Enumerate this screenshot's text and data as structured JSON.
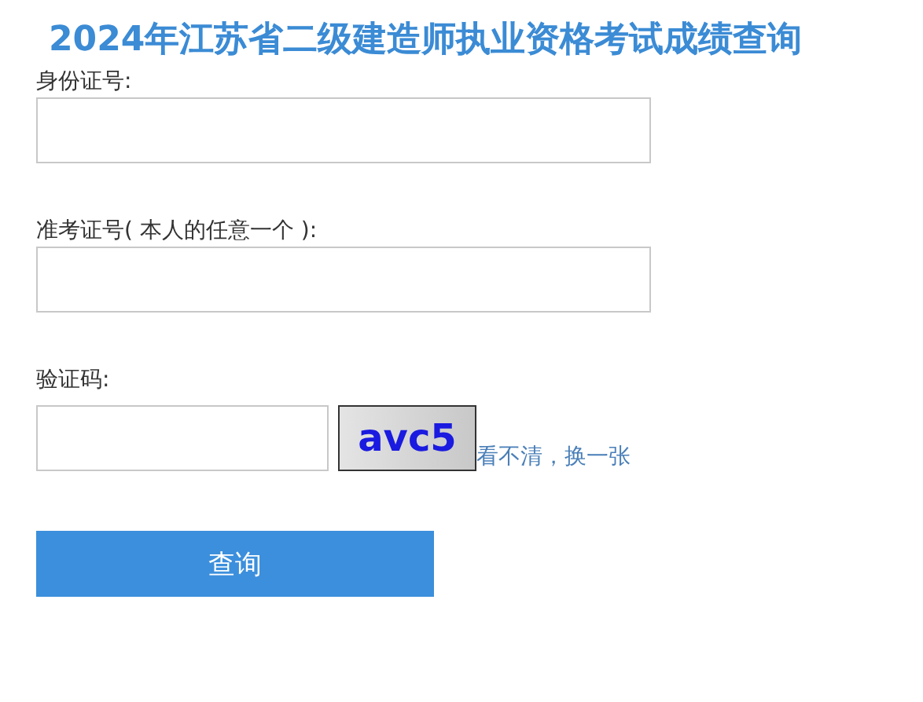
{
  "title": "2024年江苏省二级建造师执业资格考试成绩查询",
  "fields": [
    {
      "label": "身份证号:"
    },
    {
      "label": "准考证号( 本人的任意一个 ):"
    }
  ],
  "captcha": {
    "label": "验证码:",
    "code": "avc5",
    "refresh_link": "看不清，换一张"
  },
  "submit_button": "查询"
}
